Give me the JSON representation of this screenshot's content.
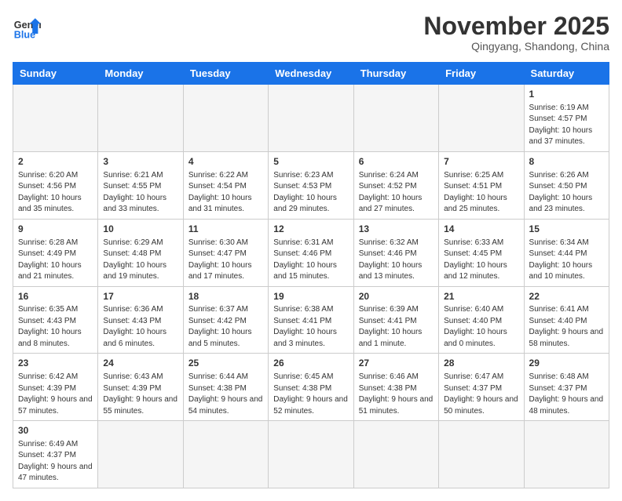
{
  "logo": {
    "text_general": "General",
    "text_blue": "Blue"
  },
  "title": "November 2025",
  "subtitle": "Qingyang, Shandong, China",
  "weekdays": [
    "Sunday",
    "Monday",
    "Tuesday",
    "Wednesday",
    "Thursday",
    "Friday",
    "Saturday"
  ],
  "weeks": [
    [
      {
        "day": "",
        "info": ""
      },
      {
        "day": "",
        "info": ""
      },
      {
        "day": "",
        "info": ""
      },
      {
        "day": "",
        "info": ""
      },
      {
        "day": "",
        "info": ""
      },
      {
        "day": "",
        "info": ""
      },
      {
        "day": "1",
        "info": "Sunrise: 6:19 AM\nSunset: 4:57 PM\nDaylight: 10 hours and 37 minutes."
      }
    ],
    [
      {
        "day": "2",
        "info": "Sunrise: 6:20 AM\nSunset: 4:56 PM\nDaylight: 10 hours and 35 minutes."
      },
      {
        "day": "3",
        "info": "Sunrise: 6:21 AM\nSunset: 4:55 PM\nDaylight: 10 hours and 33 minutes."
      },
      {
        "day": "4",
        "info": "Sunrise: 6:22 AM\nSunset: 4:54 PM\nDaylight: 10 hours and 31 minutes."
      },
      {
        "day": "5",
        "info": "Sunrise: 6:23 AM\nSunset: 4:53 PM\nDaylight: 10 hours and 29 minutes."
      },
      {
        "day": "6",
        "info": "Sunrise: 6:24 AM\nSunset: 4:52 PM\nDaylight: 10 hours and 27 minutes."
      },
      {
        "day": "7",
        "info": "Sunrise: 6:25 AM\nSunset: 4:51 PM\nDaylight: 10 hours and 25 minutes."
      },
      {
        "day": "8",
        "info": "Sunrise: 6:26 AM\nSunset: 4:50 PM\nDaylight: 10 hours and 23 minutes."
      }
    ],
    [
      {
        "day": "9",
        "info": "Sunrise: 6:28 AM\nSunset: 4:49 PM\nDaylight: 10 hours and 21 minutes."
      },
      {
        "day": "10",
        "info": "Sunrise: 6:29 AM\nSunset: 4:48 PM\nDaylight: 10 hours and 19 minutes."
      },
      {
        "day": "11",
        "info": "Sunrise: 6:30 AM\nSunset: 4:47 PM\nDaylight: 10 hours and 17 minutes."
      },
      {
        "day": "12",
        "info": "Sunrise: 6:31 AM\nSunset: 4:46 PM\nDaylight: 10 hours and 15 minutes."
      },
      {
        "day": "13",
        "info": "Sunrise: 6:32 AM\nSunset: 4:46 PM\nDaylight: 10 hours and 13 minutes."
      },
      {
        "day": "14",
        "info": "Sunrise: 6:33 AM\nSunset: 4:45 PM\nDaylight: 10 hours and 12 minutes."
      },
      {
        "day": "15",
        "info": "Sunrise: 6:34 AM\nSunset: 4:44 PM\nDaylight: 10 hours and 10 minutes."
      }
    ],
    [
      {
        "day": "16",
        "info": "Sunrise: 6:35 AM\nSunset: 4:43 PM\nDaylight: 10 hours and 8 minutes."
      },
      {
        "day": "17",
        "info": "Sunrise: 6:36 AM\nSunset: 4:43 PM\nDaylight: 10 hours and 6 minutes."
      },
      {
        "day": "18",
        "info": "Sunrise: 6:37 AM\nSunset: 4:42 PM\nDaylight: 10 hours and 5 minutes."
      },
      {
        "day": "19",
        "info": "Sunrise: 6:38 AM\nSunset: 4:41 PM\nDaylight: 10 hours and 3 minutes."
      },
      {
        "day": "20",
        "info": "Sunrise: 6:39 AM\nSunset: 4:41 PM\nDaylight: 10 hours and 1 minute."
      },
      {
        "day": "21",
        "info": "Sunrise: 6:40 AM\nSunset: 4:40 PM\nDaylight: 10 hours and 0 minutes."
      },
      {
        "day": "22",
        "info": "Sunrise: 6:41 AM\nSunset: 4:40 PM\nDaylight: 9 hours and 58 minutes."
      }
    ],
    [
      {
        "day": "23",
        "info": "Sunrise: 6:42 AM\nSunset: 4:39 PM\nDaylight: 9 hours and 57 minutes."
      },
      {
        "day": "24",
        "info": "Sunrise: 6:43 AM\nSunset: 4:39 PM\nDaylight: 9 hours and 55 minutes."
      },
      {
        "day": "25",
        "info": "Sunrise: 6:44 AM\nSunset: 4:38 PM\nDaylight: 9 hours and 54 minutes."
      },
      {
        "day": "26",
        "info": "Sunrise: 6:45 AM\nSunset: 4:38 PM\nDaylight: 9 hours and 52 minutes."
      },
      {
        "day": "27",
        "info": "Sunrise: 6:46 AM\nSunset: 4:38 PM\nDaylight: 9 hours and 51 minutes."
      },
      {
        "day": "28",
        "info": "Sunrise: 6:47 AM\nSunset: 4:37 PM\nDaylight: 9 hours and 50 minutes."
      },
      {
        "day": "29",
        "info": "Sunrise: 6:48 AM\nSunset: 4:37 PM\nDaylight: 9 hours and 48 minutes."
      }
    ],
    [
      {
        "day": "30",
        "info": "Sunrise: 6:49 AM\nSunset: 4:37 PM\nDaylight: 9 hours and 47 minutes."
      },
      {
        "day": "",
        "info": ""
      },
      {
        "day": "",
        "info": ""
      },
      {
        "day": "",
        "info": ""
      },
      {
        "day": "",
        "info": ""
      },
      {
        "day": "",
        "info": ""
      },
      {
        "day": "",
        "info": ""
      }
    ]
  ]
}
